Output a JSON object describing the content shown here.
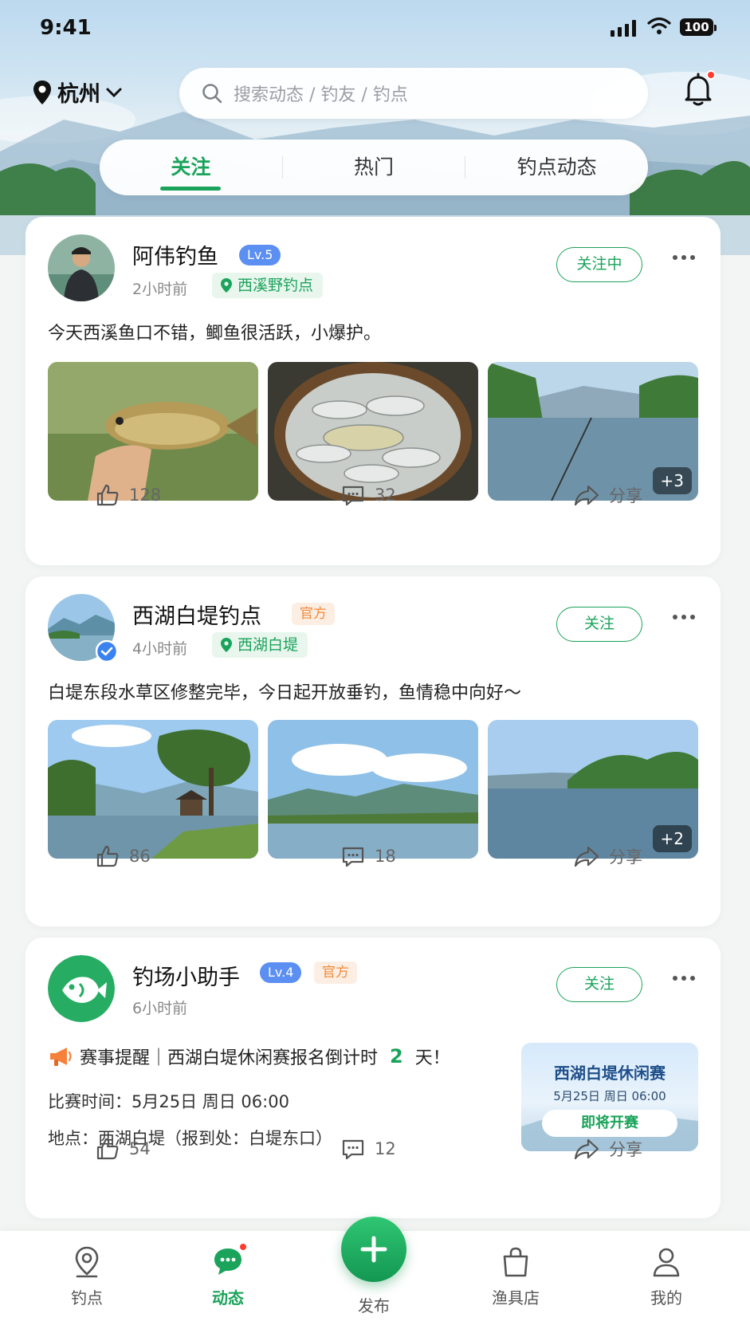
{
  "status_bar": {
    "time": "9:41",
    "battery": "100"
  },
  "header": {
    "city": "杭州",
    "search_placeholder": "搜索动态 / 钓友 / 钓点"
  },
  "tabs": [
    {
      "label": "关注",
      "active": true
    },
    {
      "label": "热门",
      "active": false
    },
    {
      "label": "钓点动态",
      "active": false
    }
  ],
  "posts": [
    {
      "author": "阿伟钓鱼",
      "level": "Lv.5",
      "time_ago": "2小时前",
      "location": "西溪野钓点",
      "follow_label": "关注中",
      "text": "今天西溪鱼口不错，鲫鱼很活跃，小爆护。",
      "more_photos": "+3",
      "likes": "128",
      "comments": "32",
      "share_label": "分享"
    },
    {
      "author": "西湖白堤钓点",
      "badge": "官方",
      "time_ago": "4小时前",
      "location": "西湖白堤",
      "follow_label": "关注",
      "text": "白堤东段水草区修整完毕，今日起开放垂钓，鱼情稳中向好～",
      "more_photos": "+2",
      "likes": "86",
      "comments": "18",
      "share_label": "分享"
    },
    {
      "author": "钓场小助手",
      "level": "Lv.4",
      "badge": "官方",
      "time_ago": "6小时前",
      "follow_label": "关注",
      "headline_prefix": "赛事提醒｜西湖白堤休闲赛报名倒计时 ",
      "headline_days": "2",
      "headline_suffix": " 天！",
      "match_time": "比赛时间：5月25日 周日 06:00",
      "place": "地点：西湖白堤（报到处：白堤东口）",
      "event_card": {
        "title": "西湖白堤休闲赛",
        "date": "5月25日  周日 06:00",
        "cta": "即将开赛"
      },
      "likes": "54",
      "comments": "12",
      "share_label": "分享"
    }
  ],
  "bottom_nav": [
    {
      "label": "钓点",
      "icon": "map-pin-icon"
    },
    {
      "label": "动态",
      "icon": "chat-bubble-icon",
      "active": true
    },
    {
      "label": "发布",
      "icon": "plus-icon"
    },
    {
      "label": "渔具店",
      "icon": "shopping-bag-icon"
    },
    {
      "label": "我的",
      "icon": "user-icon"
    }
  ],
  "colors": {
    "accent": "#1aa35a",
    "level_badge": "#5b8ff2",
    "official_badge": "#f08a3a",
    "notify_dot": "#ff3b30"
  }
}
